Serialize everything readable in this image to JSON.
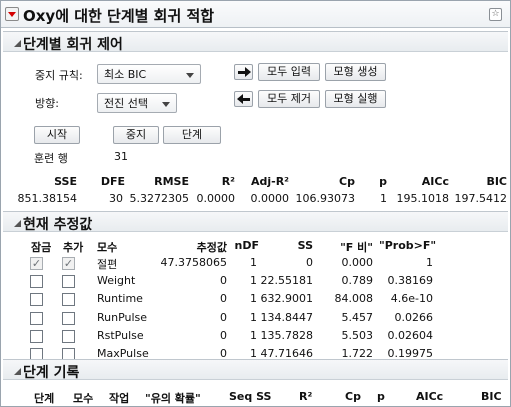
{
  "title_bar": {
    "title": "Oxy에 대한 단계별 회귀 적합",
    "menu_icon": "red-triangle-menu-icon",
    "pin_icon": "pin-icon"
  },
  "control_section": {
    "header": "단계별 회귀 제어",
    "stopping_rule_label": "중지 규칙:",
    "stopping_rule_value": "최소 BIC",
    "direction_label": "방향:",
    "direction_value": "전진 선택",
    "enter_all_button": "모두 입력",
    "make_model_button": "모형 생성",
    "remove_all_button": "모두 제거",
    "run_model_button": "모형 실행",
    "go_button": "시작",
    "stop_button": "중지",
    "step_button": "단계",
    "rows_label": "훈련 행",
    "rows_value": "31",
    "stats_headers": [
      "SSE",
      "DFE",
      "RMSE",
      "R²",
      "Adj-R²",
      "Cp",
      "p",
      "AICc",
      "BIC"
    ],
    "stats_values": [
      "851.38154",
      "30",
      "5.3272305",
      "0.0000",
      "0.0000",
      "106.93073",
      "1",
      "195.1018",
      "197.5412"
    ]
  },
  "estimates_section": {
    "header": "현재 추정값",
    "columns": [
      "잠금",
      "추가",
      "모수",
      "추정값",
      "nDF",
      "SS",
      "\"F 비\"",
      "\"Prob>F\""
    ],
    "rows": [
      {
        "lock": true,
        "entered": true,
        "disabled": true,
        "param": "절편",
        "estimate": "47.3758065",
        "ndf": "1",
        "ss": "0",
        "f": "0.000",
        "prob": "1"
      },
      {
        "lock": false,
        "entered": false,
        "disabled": false,
        "param": "Weight",
        "estimate": "0",
        "ndf": "1",
        "ss": "22.55181",
        "f": "0.789",
        "prob": "0.38169"
      },
      {
        "lock": false,
        "entered": false,
        "disabled": false,
        "param": "Runtime",
        "estimate": "0",
        "ndf": "1",
        "ss": "632.9001",
        "f": "84.008",
        "prob": "4.6e-10"
      },
      {
        "lock": false,
        "entered": false,
        "disabled": false,
        "param": "RunPulse",
        "estimate": "0",
        "ndf": "1",
        "ss": "134.8447",
        "f": "5.457",
        "prob": "0.0266"
      },
      {
        "lock": false,
        "entered": false,
        "disabled": false,
        "param": "RstPulse",
        "estimate": "0",
        "ndf": "1",
        "ss": "135.7828",
        "f": "5.503",
        "prob": "0.02604"
      },
      {
        "lock": false,
        "entered": false,
        "disabled": false,
        "param": "MaxPulse",
        "estimate": "0",
        "ndf": "1",
        "ss": "47.71646",
        "f": "1.722",
        "prob": "0.19975"
      }
    ]
  },
  "history_section": {
    "header": "단계 기록",
    "columns": [
      "단계",
      "모수",
      "작업",
      "\"유의 확률\"",
      "Seq SS",
      "R²",
      "Cp",
      "p",
      "AICc",
      "BIC"
    ]
  }
}
